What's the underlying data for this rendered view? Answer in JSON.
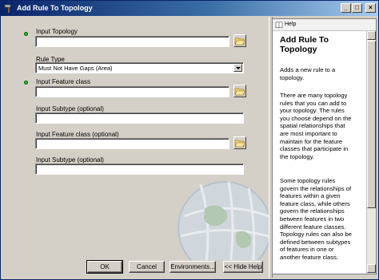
{
  "window": {
    "title": "Add Rule To Topology",
    "controls": {
      "minimize": "_",
      "maximize": "□",
      "close": "×"
    }
  },
  "form": {
    "input_topology": {
      "label": "Input Topology",
      "value": "",
      "required": true
    },
    "rule_type": {
      "label": "Rule Type",
      "selected": "Must Not Have Gaps (Area)"
    },
    "input_feature_class": {
      "label": "Input Feature class",
      "value": "",
      "required": true
    },
    "input_subtype": {
      "label": "Input Subtype (optional)",
      "value": ""
    },
    "input_feature_class_optional": {
      "label": "Input Feature class (optional)",
      "value": ""
    },
    "input_subtype_optional": {
      "label": "Input Subtype (optional)",
      "value": ""
    }
  },
  "buttons": {
    "ok": "OK",
    "cancel": "Cancel",
    "environments": "Environments...",
    "hide_help": "<< Hide Help"
  },
  "help": {
    "tab_label": "Help",
    "title_lines": [
      "Add Rule To",
      "Topology"
    ],
    "paragraph1": [
      "Adds a new rule to a",
      "topology."
    ],
    "paragraph2": [
      "There are many topology",
      "rules that you can add to",
      "your topology. The rules",
      "you choose depend on the",
      "spatial relationships that",
      "are most important to",
      "maintain for the feature",
      "classes that participate in",
      "the topology."
    ],
    "paragraph3": [
      "Some topology rules",
      "govern the relationships of",
      "features within a given",
      "feature class, while others",
      "govern the relationships",
      "between features in two",
      "different feature classes.",
      "Topology rules can also be",
      "defined between subtypes",
      "of features in one or",
      "another feature class."
    ]
  },
  "icons": {
    "title": "hammer-icon",
    "browse": "folder-open-icon",
    "globe": "globe-watermark-icon"
  },
  "colors": {
    "title_start": "#0a246a",
    "title_end": "#a6caf0",
    "required_dot": "#2db42d",
    "dialog_bg": "#d4d0c8"
  }
}
